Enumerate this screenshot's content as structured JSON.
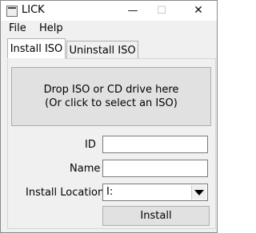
{
  "window": {
    "title": "LICK"
  },
  "titlebar": {
    "minimize": "—",
    "maximize": "☐",
    "close": "✕"
  },
  "menu": {
    "items": [
      "File",
      "Help"
    ]
  },
  "tabs": [
    {
      "label": "Install ISO",
      "selected": true
    },
    {
      "label": "Uninstall ISO",
      "selected": false
    }
  ],
  "install": {
    "drop_line1": "Drop ISO or CD drive here",
    "drop_line2": "(Or click to select an ISO)",
    "id_label": "ID",
    "id_value": "",
    "name_label": "Name",
    "name_value": "",
    "location_label": "Install Location",
    "location_value": "I:",
    "install_button": "Install"
  }
}
